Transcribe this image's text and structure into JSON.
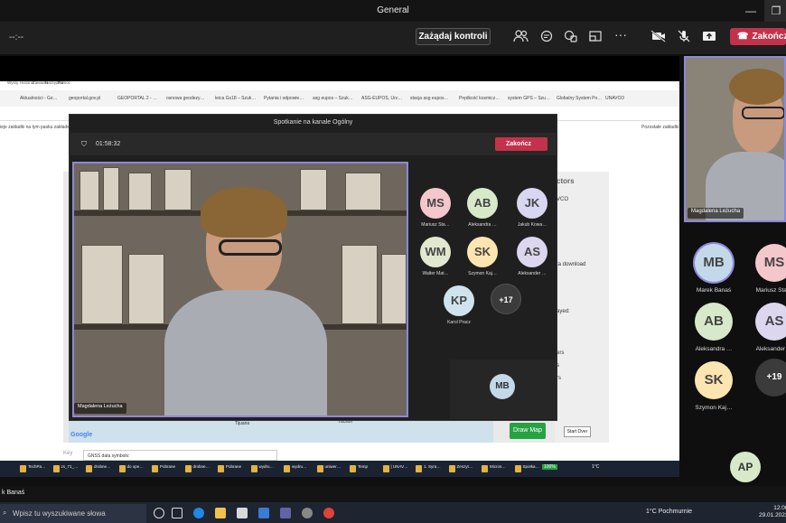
{
  "window": {
    "title": "General"
  },
  "toolbar": {
    "timer": "--:--",
    "request_control": "Zażądaj kontroli",
    "end_label": "Zakończ"
  },
  "browser": {
    "tabs": [
      "Aktualności - Ge…",
      "geoportal.gov.pl",
      "GEOPORTAL 2 - …",
      "osnowa geodezy…",
      "leica Gs18 – Szuk…",
      "Pytania i odpowie…",
      "asg eupos – Szuk…",
      "ASG-EUPOS, Urz…",
      "stacja asg eupos…",
      "Prędkość kosmicz…",
      "system GPS – Szu…",
      "Globalny System Po…",
      "UNAVCO"
    ],
    "menu": [
      "Wyślij",
      "Historia",
      "Zakładki",
      "Narzędzia",
      "Pomoc"
    ],
    "bookmark_hint": "Pozostałe zakładki",
    "bookmark_left": "ieje zakładki na tym pasku zakładek",
    "right_labels": [
      "ctors",
      "VCO",
      "ta download",
      "ayed:",
      "ers",
      "s",
      "rs"
    ],
    "draw_map": "Draw Map",
    "start_over": "Start Over",
    "gnss": "GNSS data symbols:",
    "key": "Key",
    "map_places": [
      "Tijuana",
      "Tucson"
    ]
  },
  "inner_taskbar": [
    "TechPa…",
    "zs_71_…",
    "drobne…",
    "do ope…",
    "Pobrane",
    "drobne…",
    "Pobrane",
    "wydru…",
    "wydru…",
    "uniwer…",
    "Temp",
    "| UNAV…",
    "1. Syra…",
    "Zeszyt…",
    "Micros…",
    "Spotka…"
  ],
  "inner_meeting": {
    "title": "Spotkanie na kanale Ogólny",
    "timer": "01:58:32",
    "end_label": "Zakończ",
    "speaker_name": "Magdalena Leżucha",
    "participants": [
      {
        "initials": "MS",
        "name": "Mariusz Sta…",
        "color": "#f4c7cc"
      },
      {
        "initials": "AB",
        "name": "Aleksandra …",
        "color": "#d7e9c9"
      },
      {
        "initials": "JK",
        "name": "Jakub Kowa…",
        "color": "#d8d6f0"
      },
      {
        "initials": "WM",
        "name": "Walter Mat…",
        "color": "#e1e8cf"
      },
      {
        "initials": "SK",
        "name": "Szymon Kaj…",
        "color": "#fce5b0"
      },
      {
        "initials": "AS",
        "name": "Aleksander …",
        "color": "#dcd7ee"
      },
      {
        "initials": "KP",
        "name": "Karol Pracz",
        "color": "#cfe3ee"
      }
    ],
    "more": "+17",
    "self_initials": "MB"
  },
  "right_panel": {
    "speaker_name": "Magdalena Leżucha",
    "participants": [
      {
        "initials": "MB",
        "name": "Marek Banaś",
        "color": "#c3d9ea"
      },
      {
        "initials": "MS",
        "name": "Mariusz Sta…",
        "color": "#f4c7cc"
      },
      {
        "initials": "AB",
        "name": "Aleksandra …",
        "color": "#d7e9c9"
      },
      {
        "initials": "AS",
        "name": "Aleksander …",
        "color": "#dcd7ee"
      },
      {
        "initials": "SK",
        "name": "Szymon Kaj…",
        "color": "#fce5b0"
      }
    ],
    "more": "+19",
    "self_initials": "AP"
  },
  "bottom": {
    "self_name": "k Banaś",
    "search_placeholder": "Wpisz tu wyszukiwane słowa",
    "weather": "1°C Pochmurnie",
    "time": "12:00",
    "date": "29.01.2022",
    "inner_weather": "1°C",
    "inner_battery": "100%"
  }
}
